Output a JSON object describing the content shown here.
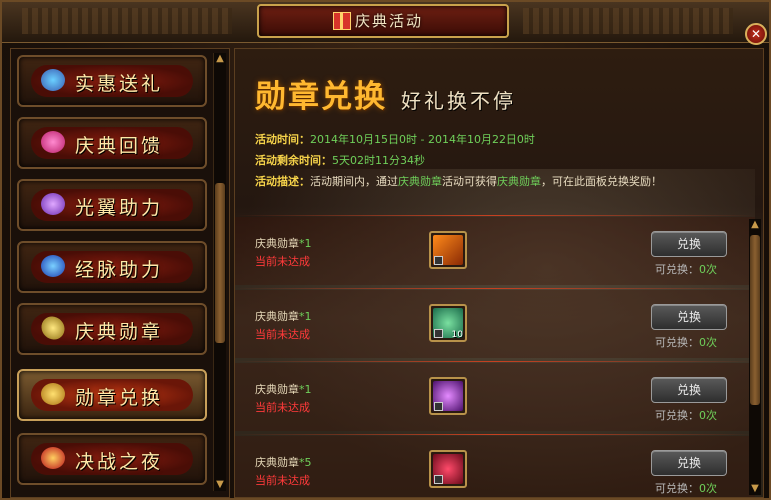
{
  "window": {
    "title": "庆典活动",
    "close_glyph": "✕"
  },
  "menu": {
    "items": [
      {
        "label": "实惠送礼",
        "icon": "gift-bag-icon"
      },
      {
        "label": "庆典回馈",
        "icon": "heart-gift-icon"
      },
      {
        "label": "光翼助力",
        "icon": "wing-icon"
      },
      {
        "label": "经脉助力",
        "icon": "meridian-orb-icon"
      },
      {
        "label": "庆典勋章",
        "icon": "medal-icon"
      },
      {
        "label": "勋章兑换",
        "icon": "exchange-icon",
        "active": true
      },
      {
        "label": "决战之夜",
        "icon": "trophy-icon"
      }
    ],
    "scroll_up": "▲",
    "scroll_down": "▼"
  },
  "panel": {
    "headline": "勋章兑换",
    "subhead": "好礼换不停",
    "time_label": "活动时间：",
    "time_value": "2014年10月15日0时 - 2014年10月22日0时",
    "remain_label": "活动剩余时间：",
    "remain_value": "5天02时11分34秒",
    "desc_label": "活动描述：",
    "desc_part1": "活动期间内，通过",
    "desc_hl1": "庆典勋章",
    "desc_part2": "活动可获得",
    "desc_hl2": "庆典勋章",
    "desc_part3": "，可在此面板兑换奖励！",
    "rows": [
      {
        "name": "庆典勋章",
        "qty": "*1",
        "status": "当前未达成",
        "button": "兑换",
        "can_label": "可兑换：",
        "can_value": "0次",
        "count": ""
      },
      {
        "name": "庆典勋章",
        "qty": "*1",
        "status": "当前未达成",
        "button": "兑换",
        "can_label": "可兑换：",
        "can_value": "0次",
        "count": "10"
      },
      {
        "name": "庆典勋章",
        "qty": "*1",
        "status": "当前未达成",
        "button": "兑换",
        "can_label": "可兑换：",
        "can_value": "0次",
        "count": ""
      },
      {
        "name": "庆典勋章",
        "qty": "*5",
        "status": "当前未达成",
        "button": "兑换",
        "can_label": "可兑换：",
        "can_value": "0次",
        "count": ""
      }
    ],
    "scroll_up": "▲",
    "scroll_down": "▼"
  }
}
